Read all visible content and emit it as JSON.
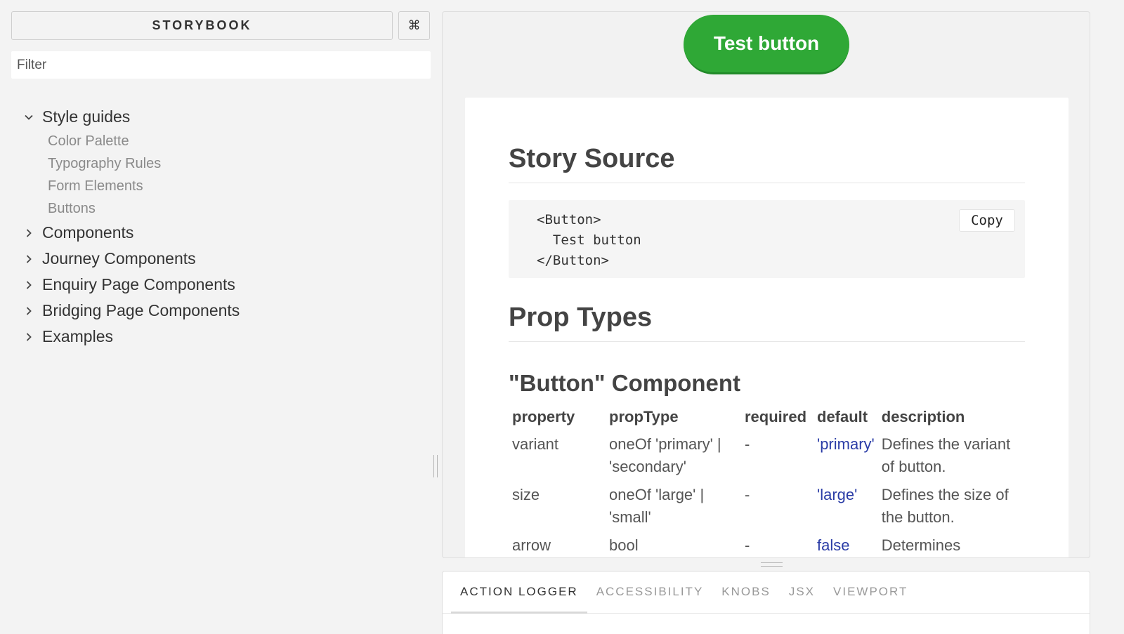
{
  "sidebar": {
    "brand": "STORYBOOK",
    "shortcut_glyph": "⌘",
    "filter_placeholder": "Filter",
    "tree": [
      {
        "label": "Style guides",
        "expanded": true,
        "children": [
          "Color Palette",
          "Typography Rules",
          "Form Elements",
          "Buttons"
        ]
      },
      {
        "label": "Components",
        "expanded": false
      },
      {
        "label": "Journey Components",
        "expanded": false
      },
      {
        "label": "Enquiry Page Components",
        "expanded": false
      },
      {
        "label": "Bridging Page Components",
        "expanded": false
      },
      {
        "label": "Examples",
        "expanded": false
      }
    ]
  },
  "preview": {
    "test_button_label": "Test button",
    "story_source_title": "Story Source",
    "code": "<Button>\n  Test button\n</Button>",
    "copy_label": "Copy",
    "prop_types_title": "Prop Types",
    "component_title": "\"Button\" Component",
    "table": {
      "headers": [
        "property",
        "propType",
        "required",
        "default",
        "description"
      ],
      "rows": [
        [
          "variant",
          "oneOf 'primary' | 'secondary'",
          "-",
          "'primary'",
          "Defines the variant of button."
        ],
        [
          "size",
          "oneOf 'large' | 'small'",
          "-",
          "'large'",
          "Defines the size of the button."
        ],
        [
          "arrow",
          "bool",
          "-",
          "false",
          "Determines whether"
        ]
      ]
    }
  },
  "addons": {
    "tabs": [
      "ACTION LOGGER",
      "ACCESSIBILITY",
      "KNOBS",
      "JSX",
      "VIEWPORT"
    ],
    "active_tab": 0
  },
  "colors": {
    "button_green": "#2fa836",
    "default_value_blue": "#2a3ca6",
    "sidebar_bg": "#f3f3f3"
  }
}
